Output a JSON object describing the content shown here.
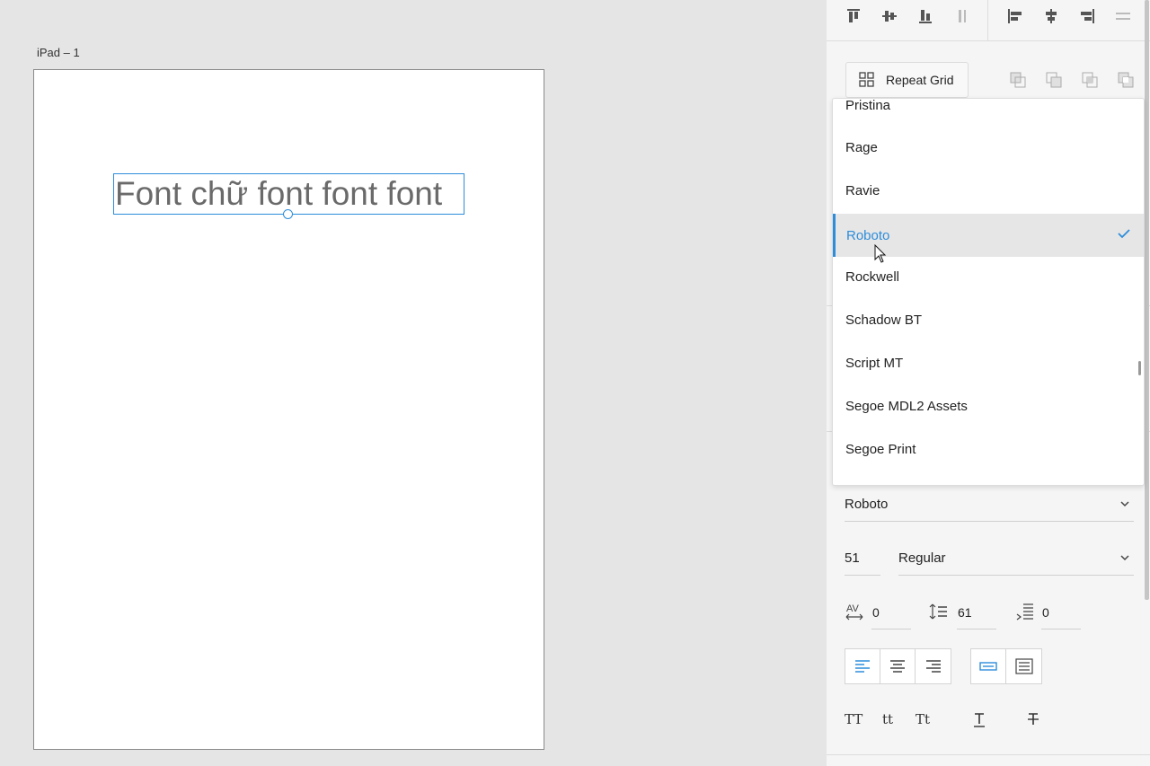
{
  "canvas": {
    "artboard_label": "iPad – 1",
    "text_content": "Font chữ font font font"
  },
  "toolbar": {
    "align_icons": [
      "align-top-icon",
      "align-middle-icon",
      "align-bottom-icon",
      "distribute-vertical-icon",
      "align-left-icon",
      "align-center-icon",
      "align-right-icon",
      "distribute-horizontal-icon"
    ],
    "repeat_grid_label": "Repeat Grid",
    "boolean_icons": [
      "subtract-icon",
      "add-icon",
      "intersect-icon",
      "exclude-icon"
    ]
  },
  "font_dropdown": {
    "items": [
      "Pristina",
      "Rage",
      "Ravie",
      "Roboto",
      "Rockwell",
      "Schadow BT",
      "Script MT",
      "Segoe MDL2 Assets",
      "Segoe Print"
    ],
    "selected": "Roboto"
  },
  "text_props": {
    "font_family": "Roboto",
    "font_size": "51",
    "font_weight": "Regular",
    "char_spacing": "0",
    "line_spacing": "61",
    "paragraph_spacing": "0",
    "case_labels": [
      "TT",
      "tt",
      "Tt"
    ]
  },
  "colors": {
    "accent": "#2d8ddb",
    "canvas_bg": "#e5e5e5",
    "panel_bg": "#f5f5f5"
  }
}
